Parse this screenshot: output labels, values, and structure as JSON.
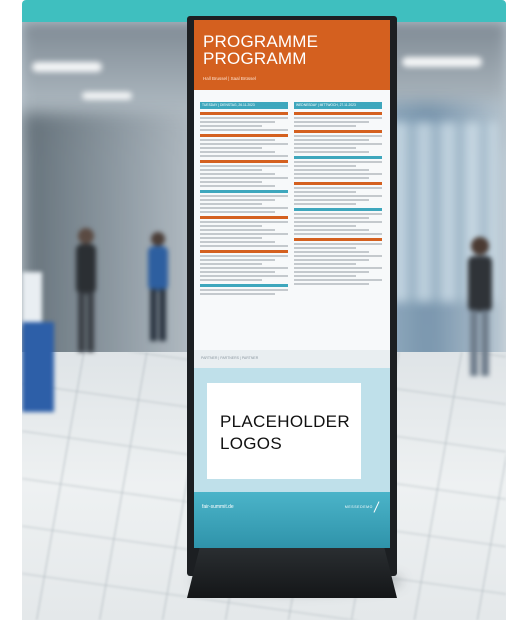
{
  "poster": {
    "title": "PROGRAMME\nPROGRAMM",
    "subtitle": "Hall Brussel | Saal Brüssel",
    "day_left": "TUESDAY | DIENSTAG, 26.11.2023",
    "day_right": "WEDNESDAY | MITTWOCH, 27.11.2023",
    "partners_label": "PARTNER | PARTNERS | PARTNER",
    "logos_placeholder": "PLACEHOLDER\nLOGOS",
    "url": "fair-summit.de",
    "brand": "MESSEDEMO"
  },
  "colors": {
    "accent_teal": "#3fbfbf",
    "header_orange": "#d4601f",
    "schedule_teal": "#3ea7bd",
    "logo_panel": "#bfe0ea"
  }
}
